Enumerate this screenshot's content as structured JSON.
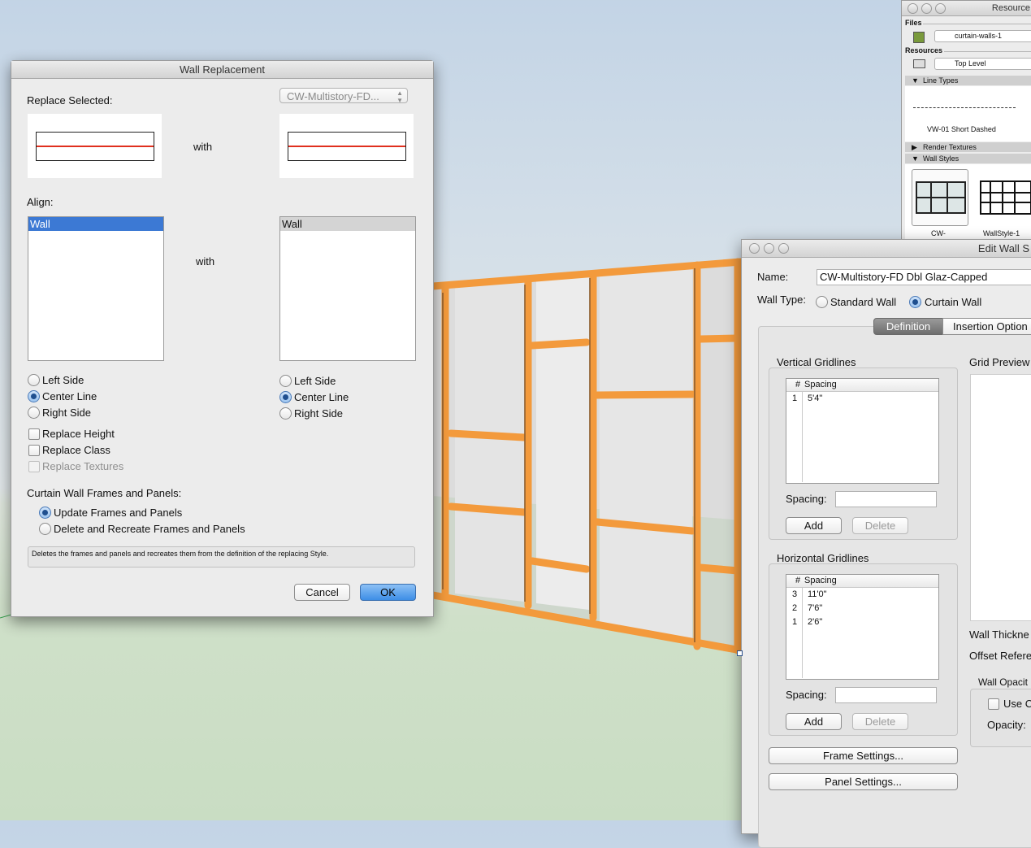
{
  "wall_replacement": {
    "title": "Wall Replacement",
    "replace_selected_label": "Replace Selected:",
    "style_popup_value": "CW-Multistory-FD...",
    "with_label_top": "with",
    "align_label": "Align:",
    "with_label_align": "with",
    "left_list_item": "Wall",
    "right_list_item": "Wall",
    "left_align_options": [
      {
        "label": "Left Side",
        "selected": false
      },
      {
        "label": "Center Line",
        "selected": true
      },
      {
        "label": "Right Side",
        "selected": false
      }
    ],
    "right_align_options": [
      {
        "label": "Left Side",
        "selected": false
      },
      {
        "label": "Center Line",
        "selected": true
      },
      {
        "label": "Right Side",
        "selected": false
      }
    ],
    "replace_height": "Replace Height",
    "replace_class": "Replace Class",
    "replace_textures": "Replace Textures",
    "cw_section_label": "Curtain Wall Frames and Panels:",
    "cw_options": [
      {
        "label": "Update Frames and Panels",
        "selected": true
      },
      {
        "label": "Delete and Recreate Frames and Panels",
        "selected": false
      }
    ],
    "help_text": "Deletes the frames and panels and recreates them from the definition of the replacing Style.",
    "cancel": "Cancel",
    "ok": "OK"
  },
  "resource_browser": {
    "title": "Resource",
    "files_label": "Files",
    "file_popup": "curtain-walls-1",
    "resources_label": "Resources",
    "resources_popup": "Top Level",
    "line_types_header": "Line Types",
    "line_type_name": "VW-01 Short Dashed",
    "render_textures_header": "Render Textures",
    "wall_styles_header": "Wall Styles",
    "wall_style_1": "CW-",
    "wall_style_2": "WallStyle-1"
  },
  "edit_wall_style": {
    "title": "Edit Wall S",
    "name_label": "Name:",
    "name_value": "CW-Multistory-FD Dbl Glaz-Capped",
    "wall_type_label": "Wall Type:",
    "wall_type_options": [
      {
        "label": "Standard Wall",
        "selected": false
      },
      {
        "label": "Curtain Wall",
        "selected": true
      }
    ],
    "tabs": [
      "Definition",
      "Insertion Option"
    ],
    "vertical_gridlines_label": "Vertical Gridlines",
    "vertical_header_num": "#",
    "vertical_header_spacing": "Spacing",
    "vertical_rows": [
      {
        "n": "1",
        "spacing": "5'4\""
      }
    ],
    "vertical_spacing_label": "Spacing:",
    "horizontal_gridlines_label": "Horizontal Gridlines",
    "horizontal_header_num": "#",
    "horizontal_header_spacing": "Spacing",
    "horizontal_rows": [
      {
        "n": "3",
        "spacing": "11'0\""
      },
      {
        "n": "2",
        "spacing": "7'6\""
      },
      {
        "n": "1",
        "spacing": "2'6\""
      }
    ],
    "horizontal_spacing_label": "Spacing:",
    "add": "Add",
    "delete": "Delete",
    "frame_settings": "Frame Settings...",
    "panel_settings": "Panel Settings...",
    "grid_preview_label": "Grid Preview",
    "wall_thickness_label": "Wall Thickne",
    "offset_reference_label": "Offset Refere",
    "wall_opacity_label": "Wall Opacit",
    "use_label": "Use C",
    "opacity_label": "Opacity:"
  },
  "colors": {
    "frame_orange": "#f39a3c",
    "selection_blue": "#3c79d4",
    "accent_red": "#e0301e"
  }
}
